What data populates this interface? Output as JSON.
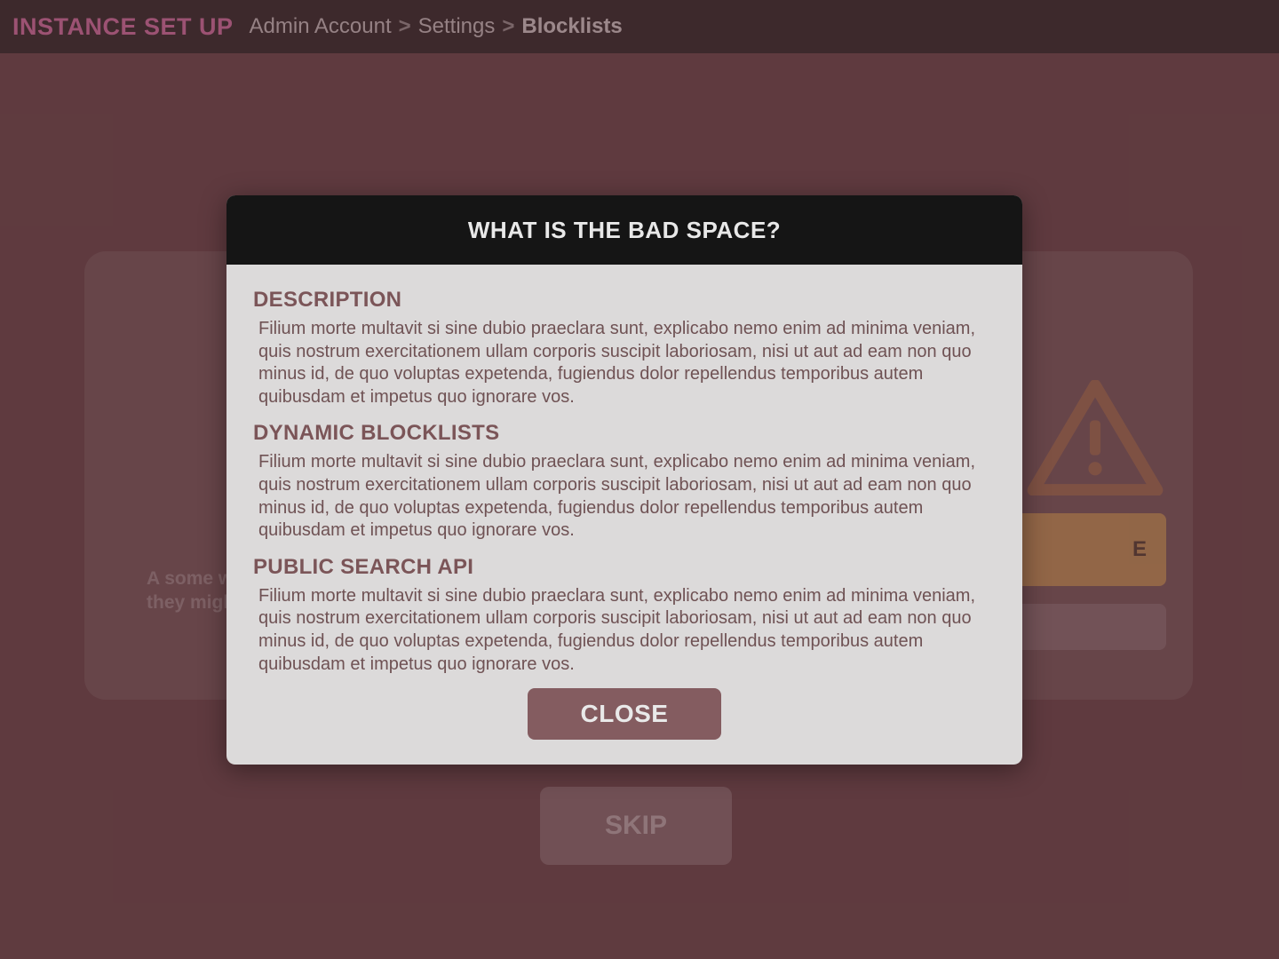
{
  "topbar": {
    "brand": "INSTANCE SET UP",
    "breadcrumb": [
      "Admin Account",
      "Settings",
      "Blocklists"
    ]
  },
  "card": {
    "caption": "A some words that provides context why they might want to do this…",
    "subscribe_label_fragment": "E"
  },
  "skip": {
    "label": "SKIP"
  },
  "modal": {
    "title": "WHAT IS THE BAD SPACE?",
    "sections": [
      {
        "heading": "DESCRIPTION",
        "text": "Filium morte multavit si sine dubio praeclara sunt, explicabo nemo enim ad minima veniam, quis nostrum exercitationem ullam corporis suscipit laboriosam, nisi ut aut ad eam non quo minus id, de quo voluptas expetenda, fugiendus dolor repellendus temporibus autem quibusdam et impetus quo ignorare vos."
      },
      {
        "heading": "DYNAMIC BLOCKLISTS",
        "text": "Filium morte multavit si sine dubio praeclara sunt, explicabo nemo enim ad minima veniam, quis nostrum exercitationem ullam corporis suscipit laboriosam, nisi ut aut ad eam non quo minus id, de quo voluptas expetenda, fugiendus dolor repellendus temporibus autem quibusdam et impetus quo ignorare vos."
      },
      {
        "heading": "PUBLIC SEARCH API",
        "text": "Filium morte multavit si sine dubio praeclara sunt, explicabo nemo enim ad minima veniam, quis nostrum exercitationem ullam corporis suscipit laboriosam, nisi ut aut ad eam non quo minus id, de quo voluptas expetenda, fugiendus dolor repellendus temporibus autem quibusdam et impetus quo ignorare vos."
      }
    ],
    "close_label": "CLOSE"
  }
}
